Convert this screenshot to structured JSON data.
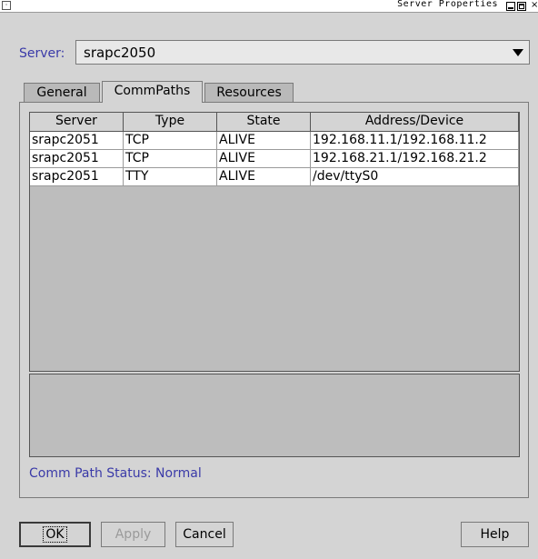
{
  "window": {
    "title": "Server Properties",
    "menu_glyph": "·",
    "close_glyph": "×"
  },
  "server": {
    "label": "Server:",
    "selected": "srapc2050"
  },
  "tabs": [
    {
      "label": "General",
      "active": false
    },
    {
      "label": "CommPaths",
      "active": true
    },
    {
      "label": "Resources",
      "active": false
    }
  ],
  "table": {
    "columns": [
      "Server",
      "Type",
      "State",
      "Address/Device"
    ],
    "rows": [
      [
        "srapc2051",
        "TCP",
        "ALIVE",
        "192.168.11.1/192.168.11.2"
      ],
      [
        "srapc2051",
        "TCP",
        "ALIVE",
        "192.168.21.1/192.168.21.2"
      ],
      [
        "srapc2051",
        "TTY",
        "ALIVE",
        "/dev/ttyS0"
      ]
    ]
  },
  "status_text": "Comm Path Status: Normal",
  "buttons": {
    "ok": "OK",
    "apply": "Apply",
    "cancel": "Cancel",
    "help": "Help"
  },
  "colors": {
    "label_blue": "#3a3aa8",
    "background": "#d4d4d4"
  }
}
